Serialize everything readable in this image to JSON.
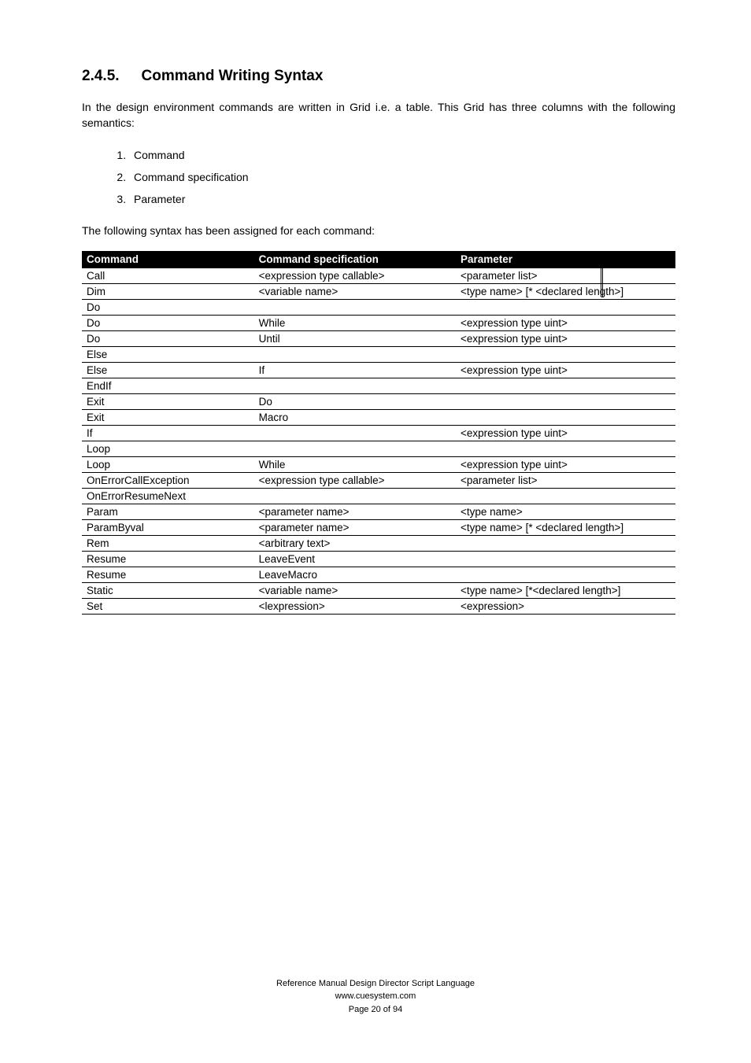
{
  "heading": {
    "number": "2.4.5.",
    "title": "Command Writing Syntax"
  },
  "intro": "In the design environment commands are written in Grid i.e. a table. This Grid has three columns with the following semantics:",
  "list": {
    "item1": "Command",
    "item2": "Command specification",
    "item3": "Parameter"
  },
  "following": "The following syntax has been assigned for each command:",
  "table": {
    "headers": {
      "h1": "Command",
      "h2": "Command specification",
      "h3": "Parameter"
    },
    "rows": [
      {
        "c1": "Call",
        "c2": "<expression type callable>",
        "c3": "<parameter list>"
      },
      {
        "c1": "Dim",
        "c2": "<variable name>",
        "c3": "<type name> [* <declared length>]"
      },
      {
        "c1": "Do",
        "c2": "",
        "c3": ""
      },
      {
        "c1": "Do",
        "c2": "While",
        "c3": "<expression type uint>"
      },
      {
        "c1": "Do",
        "c2": "Until",
        "c3": "<expression type uint>"
      },
      {
        "c1": "Else",
        "c2": "",
        "c3": ""
      },
      {
        "c1": "Else",
        "c2": "If",
        "c3": "<expression type uint>"
      },
      {
        "c1": "EndIf",
        "c2": "",
        "c3": ""
      },
      {
        "c1": "Exit",
        "c2": "Do",
        "c3": ""
      },
      {
        "c1": "Exit",
        "c2": "Macro",
        "c3": ""
      },
      {
        "c1": "If",
        "c2": "",
        "c3": "<expression type uint>"
      },
      {
        "c1": "Loop",
        "c2": "",
        "c3": ""
      },
      {
        "c1": "Loop",
        "c2": "While",
        "c3": "<expression type uint>"
      },
      {
        "c1": "OnErrorCallException",
        "c2": "<expression type callable>",
        "c3": "<parameter list>"
      },
      {
        "c1": "OnErrorResumeNext",
        "c2": "",
        "c3": ""
      },
      {
        "c1": "Param",
        "c2": "<parameter name>",
        "c3": "<type name>"
      },
      {
        "c1": "ParamByval",
        "c2": "<parameter name>",
        "c3": "<type name> [* <declared length>]"
      },
      {
        "c1": "Rem",
        "c2": "<arbitrary text>",
        "c3": ""
      },
      {
        "c1": "Resume",
        "c2": "LeaveEvent",
        "c3": ""
      },
      {
        "c1": "Resume",
        "c2": "LeaveMacro",
        "c3": ""
      },
      {
        "c1": "Static",
        "c2": "<variable name>",
        "c3": "<type name> [*<declared length>]"
      },
      {
        "c1": "Set",
        "c2": "<lexpression>",
        "c3": "<expression>"
      }
    ]
  },
  "footer": {
    "line1": "Reference Manual Design Director Script Language",
    "line2": "www.cuesystem.com",
    "line3": "Page 20 of 94"
  }
}
